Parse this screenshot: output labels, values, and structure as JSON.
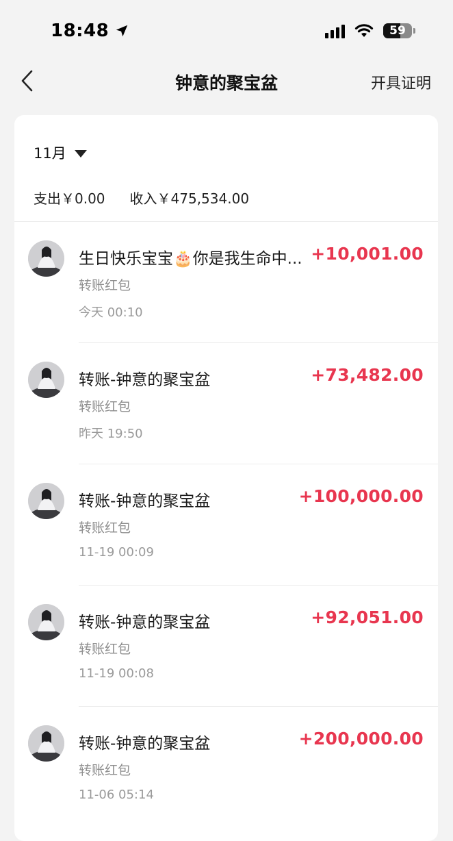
{
  "status_bar": {
    "time": "18:48",
    "battery": "59",
    "battery_level": 0.59
  },
  "nav": {
    "title": "钟意的聚宝盆",
    "action_label": "开具证明"
  },
  "filter": {
    "month": "11月"
  },
  "summary": {
    "expense": "支出￥0.00",
    "income": "收入￥475,534.00"
  },
  "transactions": [
    {
      "title": "生日快乐宝宝🎂你是我生命中...",
      "subtitle": "转账红包",
      "time": "今天 00:10",
      "amount": "+10,001.00"
    },
    {
      "title": "转账-钟意的聚宝盆",
      "subtitle": "转账红包",
      "time": "昨天 19:50",
      "amount": "+73,482.00"
    },
    {
      "title": "转账-钟意的聚宝盆",
      "subtitle": "转账红包",
      "time": "11-19 00:09",
      "amount": "+100,000.00"
    },
    {
      "title": "转账-钟意的聚宝盆",
      "subtitle": "转账红包",
      "time": "11-19 00:08",
      "amount": "+92,051.00"
    },
    {
      "title": "转账-钟意的聚宝盆",
      "subtitle": "转账红包",
      "time": "11-06 05:14",
      "amount": "+200,000.00"
    }
  ],
  "colors": {
    "amount": "#e8364f",
    "background": "#f3f3f3",
    "card": "#ffffff"
  }
}
